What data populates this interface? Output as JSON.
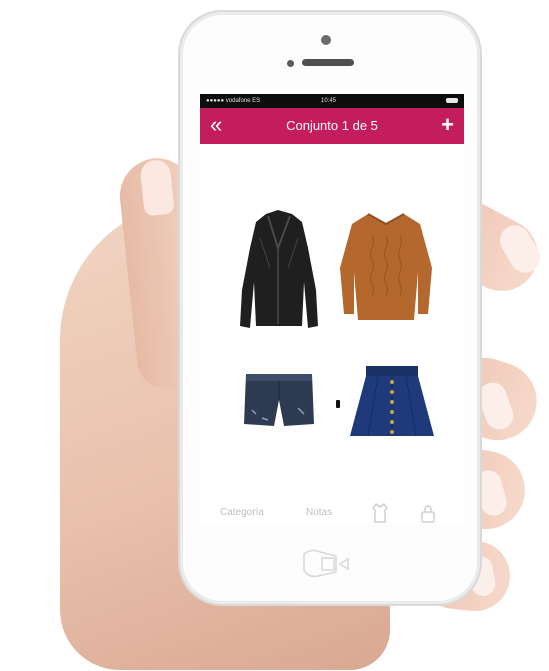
{
  "statusbar": {
    "carrier": "●●●●● vodafone ES",
    "time": "10:45"
  },
  "navbar": {
    "back_glyph": "«",
    "title": "Conjunto 1 de 5",
    "add_glyph": "+"
  },
  "outfit": {
    "items": [
      {
        "name": "leather-jacket",
        "color": "#1f1f1f"
      },
      {
        "name": "knit-sweater",
        "color": "#b5682e"
      },
      {
        "name": "denim-shorts",
        "color": "#2d3a52"
      },
      {
        "name": "navy-skirt",
        "color": "#1e3a7a"
      }
    ]
  },
  "toolbar": {
    "categoria": "Categoría",
    "notas": "Notas",
    "shirt_icon": "shirt-icon",
    "lock_icon": "lock-icon"
  },
  "colors": {
    "accent": "#c41d5b",
    "statusbar": "#0d0d0d"
  }
}
